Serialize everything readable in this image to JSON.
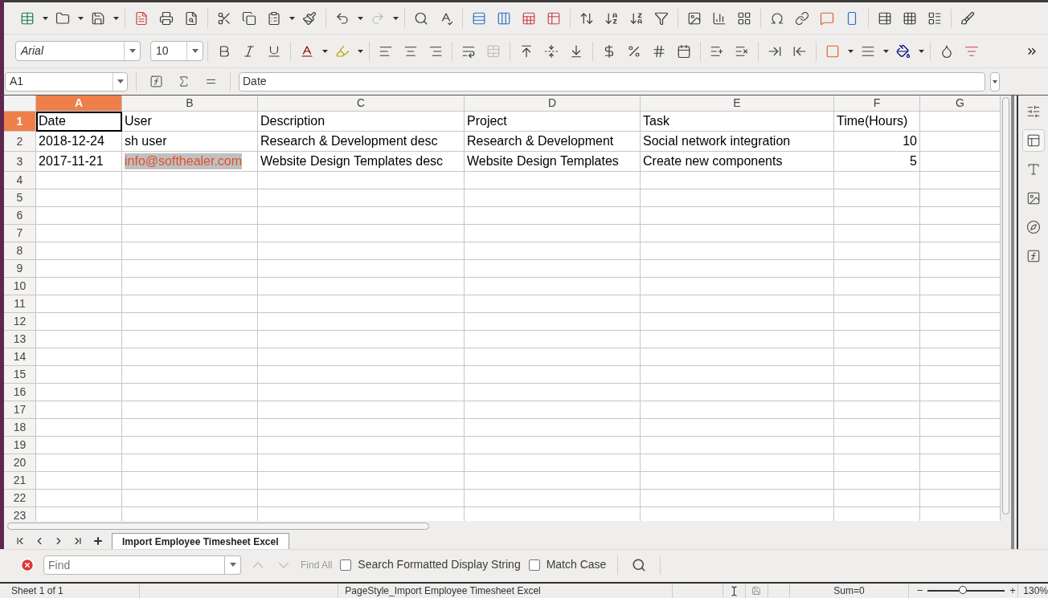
{
  "font_box": {
    "value": "Arial"
  },
  "size_box": {
    "value": "10"
  },
  "name_box": {
    "value": "A1"
  },
  "formula_bar": {
    "value": "Date"
  },
  "columns": [
    {
      "label": "A",
      "selected": true
    },
    {
      "label": "B",
      "selected": false
    },
    {
      "label": "C",
      "selected": false
    },
    {
      "label": "D",
      "selected": false
    },
    {
      "label": "E",
      "selected": false
    },
    {
      "label": "F",
      "selected": false
    },
    {
      "label": "G",
      "selected": false
    }
  ],
  "rows": [
    {
      "header": "1",
      "selected": true,
      "cells": [
        {
          "text": "Date",
          "kind": "text",
          "selected": true
        },
        {
          "text": "User",
          "kind": "text",
          "selected": false
        },
        {
          "text": "Description",
          "kind": "text",
          "selected": false
        },
        {
          "text": "Project",
          "kind": "text",
          "selected": false
        },
        {
          "text": "Task",
          "kind": "text",
          "selected": false
        },
        {
          "text": "Time(Hours)",
          "kind": "text",
          "selected": false
        }
      ]
    },
    {
      "header": "2",
      "selected": false,
      "cells": [
        {
          "text": "2018-12-24",
          "kind": "text",
          "selected": false
        },
        {
          "text": "sh user",
          "kind": "text",
          "selected": false
        },
        {
          "text": "Research & Development desc",
          "kind": "text",
          "selected": false
        },
        {
          "text": "Research & Development",
          "kind": "text",
          "selected": false
        },
        {
          "text": "Social network integration",
          "kind": "text",
          "selected": false
        },
        {
          "text": "10",
          "kind": "number",
          "selected": false
        }
      ]
    },
    {
      "header": "3",
      "selected": false,
      "cells": [
        {
          "text": "2017-11-21",
          "kind": "text",
          "selected": false
        },
        {
          "text": "info@softhealer.com",
          "kind": "link",
          "selected": false
        },
        {
          "text": "Website Design Templates desc",
          "kind": "text",
          "selected": false
        },
        {
          "text": "Website Design Templates",
          "kind": "text",
          "selected": false
        },
        {
          "text": "Create new components",
          "kind": "text",
          "selected": false
        },
        {
          "text": "5",
          "kind": "number",
          "selected": false
        }
      ]
    },
    {
      "header": "4",
      "selected": false
    },
    {
      "header": "5",
      "selected": false
    },
    {
      "header": "6",
      "selected": false
    },
    {
      "header": "7",
      "selected": false
    },
    {
      "header": "8",
      "selected": false
    },
    {
      "header": "9",
      "selected": false
    },
    {
      "header": "10",
      "selected": false
    },
    {
      "header": "11",
      "selected": false
    },
    {
      "header": "12",
      "selected": false
    },
    {
      "header": "13",
      "selected": false
    },
    {
      "header": "14",
      "selected": false
    },
    {
      "header": "15",
      "selected": false
    },
    {
      "header": "16",
      "selected": false
    },
    {
      "header": "17",
      "selected": false
    },
    {
      "header": "18",
      "selected": false
    },
    {
      "header": "19",
      "selected": false
    },
    {
      "header": "20",
      "selected": false
    },
    {
      "header": "21",
      "selected": false
    },
    {
      "header": "22",
      "selected": false
    },
    {
      "header": "23",
      "selected": false
    }
  ],
  "sheet_tabs": [
    {
      "label": "Import Employee Timesheet Excel",
      "selected": true
    }
  ],
  "find_bar": {
    "placeholder": "Find",
    "find_all": {
      "label": "Find All",
      "disabled": true
    },
    "options": [
      {
        "label": "Search Formatted Display String",
        "checked": false
      },
      {
        "label": "Match Case",
        "checked": false
      }
    ]
  },
  "status_bar": {
    "sheet": "Sheet 1 of 1",
    "page_style": "PageStyle_Import Employee Timesheet Excel",
    "sum": "Sum=0",
    "zoom_out": "−",
    "zoom_in": "+",
    "zoom": {
      "level": 0.45
    },
    "zoom_reading": "130%"
  }
}
